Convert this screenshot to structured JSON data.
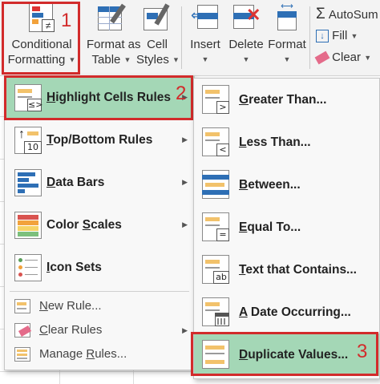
{
  "ribbon": {
    "conditional_formatting": {
      "line1": "Conditional",
      "line2": "Formatting",
      "icon": "conditional-formatting-icon"
    },
    "format_as_table": {
      "line1": "Format as",
      "line2": "Table",
      "icon": "format-as-table-icon"
    },
    "cell_styles": {
      "line1": "Cell",
      "line2": "Styles",
      "icon": "cell-styles-icon"
    },
    "insert": {
      "label": "Insert",
      "icon": "insert-cells-icon"
    },
    "delete": {
      "label": "Delete",
      "icon": "delete-cells-icon"
    },
    "format": {
      "label": "Format",
      "icon": "format-cells-icon"
    },
    "autosum": {
      "label": "AutoSum",
      "glyph": "Σ"
    },
    "fill": {
      "label": "Fill"
    },
    "clear": {
      "label": "Clear"
    }
  },
  "annotations": {
    "step1": "1",
    "step2": "2",
    "step3": "3",
    "color": "#d22b2b"
  },
  "cf_menu": {
    "items": [
      {
        "label": "Highlight Cells Rules",
        "underline": "H",
        "rest": "ighlight Cells Rules",
        "icon": "highlight-cells-rules-icon",
        "selected": true
      },
      {
        "label": "Top/Bottom Rules",
        "underline": "T",
        "rest": "op/Bottom Rules",
        "icon": "top-bottom-rules-icon"
      },
      {
        "label": "Data Bars",
        "underline": "D",
        "rest": "ata Bars",
        "icon": "data-bars-icon"
      },
      {
        "label": "Color Scales",
        "underline": "S",
        "pre": "Color ",
        "rest": "cales",
        "icon": "color-scales-icon"
      },
      {
        "label": "Icon Sets",
        "underline": "I",
        "rest": "con Sets",
        "icon": "icon-sets-icon"
      }
    ],
    "small_items": [
      {
        "label": "New Rule...",
        "underline": "N",
        "rest": "ew Rule...",
        "icon": "new-rule-icon"
      },
      {
        "label": "Clear Rules",
        "underline": "C",
        "rest": "lear Rules",
        "icon": "clear-rules-icon"
      },
      {
        "label": "Manage Rules...",
        "underline": "R",
        "pre": "Manage ",
        "rest": "ules...",
        "icon": "manage-rules-icon"
      }
    ]
  },
  "sub_menu": {
    "items": [
      {
        "label": "Greater Than...",
        "underline": "G",
        "rest": "reater Than...",
        "badge": ">"
      },
      {
        "label": "Less Than...",
        "underline": "L",
        "rest": "ess Than...",
        "badge": "<"
      },
      {
        "label": "Between...",
        "underline": "B",
        "rest": "etween...",
        "badge": ""
      },
      {
        "label": "Equal To...",
        "underline": "E",
        "rest": "qual To...",
        "badge": "="
      },
      {
        "label": "Text that Contains...",
        "underline": "T",
        "rest": "ext that Contains...",
        "badge": "ab"
      },
      {
        "label": "A Date Occurring...",
        "underline": "A",
        "rest": " Date Occurring...",
        "badge": "cal"
      },
      {
        "label": "Duplicate Values...",
        "underline": "D",
        "rest": "uplicate Values...",
        "badge": "",
        "selected": true
      }
    ]
  },
  "colors": {
    "highlight": "#a4d7b6",
    "accent_yellow": "#f2c26b",
    "blue": "#2e6fb5"
  }
}
